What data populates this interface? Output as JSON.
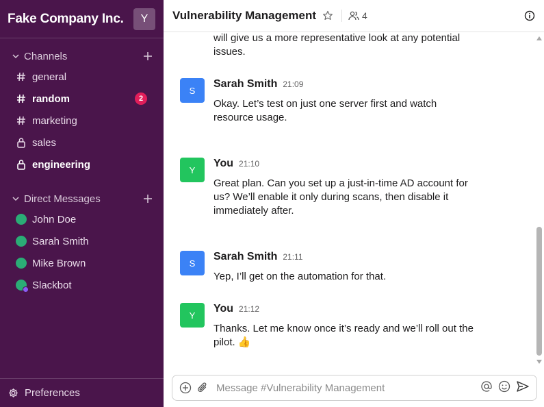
{
  "workspace": {
    "name": "Fake Company Inc.",
    "avatar_letter": "Y"
  },
  "sidebar": {
    "channels_label": "Channels",
    "channels": [
      {
        "name": "general",
        "type": "public",
        "bold": false,
        "badge": ""
      },
      {
        "name": "random",
        "type": "public",
        "bold": true,
        "badge": "2"
      },
      {
        "name": "marketing",
        "type": "public",
        "bold": false,
        "badge": ""
      },
      {
        "name": "sales",
        "type": "private",
        "bold": false,
        "badge": ""
      },
      {
        "name": "engineering",
        "type": "private",
        "bold": true,
        "badge": ""
      }
    ],
    "dm_label": "Direct Messages",
    "dms": [
      {
        "name": "John Doe",
        "status": "online"
      },
      {
        "name": "Sarah Smith",
        "status": "online"
      },
      {
        "name": "Mike Brown",
        "status": "online"
      },
      {
        "name": "Slackbot",
        "status": "bot"
      }
    ],
    "preferences_label": "Preferences"
  },
  "channel": {
    "title": "Vulnerability Management",
    "member_count": "4"
  },
  "messages": {
    "continuation": "will give us a more representative look at any potential issues.",
    "items": [
      {
        "avatar": "S",
        "author": "Sarah Smith",
        "time": "21:09",
        "text": "Okay. Let’s test on just one server first and watch resource usage."
      },
      {
        "avatar": "Y",
        "author": "You",
        "time": "21:10",
        "text": "Great plan. Can you set up a just-in-time AD account for us? We’ll enable it only during scans, then disable it immediately after."
      },
      {
        "avatar": "S",
        "author": "Sarah Smith",
        "time": "21:11",
        "text": "Yep, I’ll get on the automation for that."
      },
      {
        "avatar": "Y",
        "author": "You",
        "time": "21:12",
        "text": "Thanks. Let me know once it’s ready and we’ll roll out the pilot. 👍"
      }
    ]
  },
  "composer": {
    "placeholder": "Message #Vulnerability Management"
  },
  "colors": {
    "sidebar": "#4a154b",
    "badge": "#e01e5a",
    "presence": "#2bac76",
    "sarah_avatar": "#3b82f6",
    "you_avatar": "#22c55e"
  }
}
